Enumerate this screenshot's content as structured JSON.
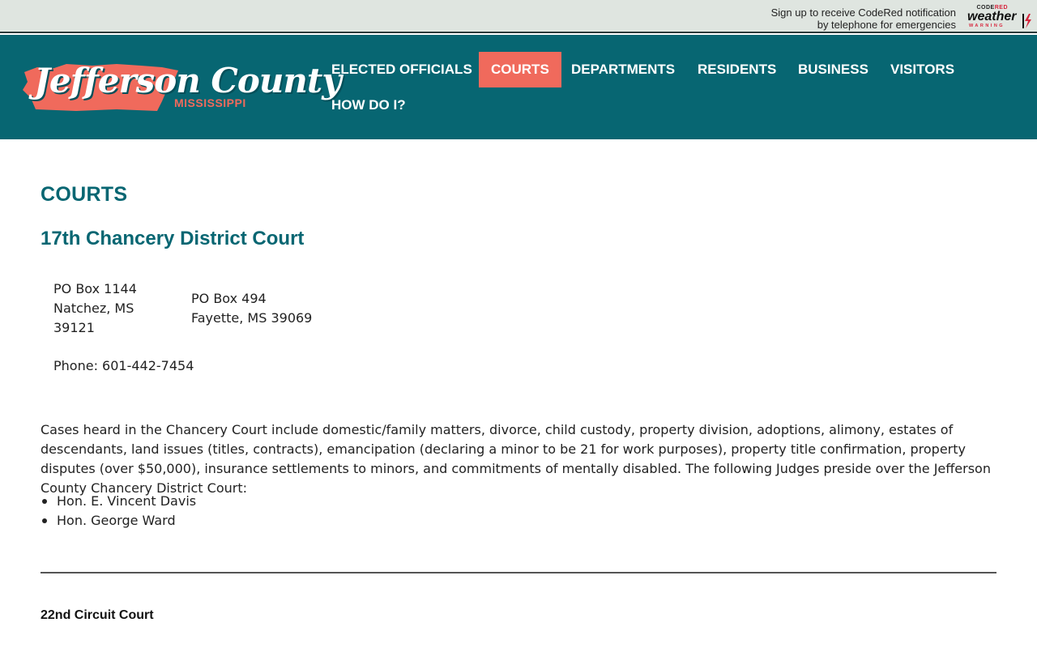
{
  "topbar": {
    "codered_line1": "Sign up to receive CodeRed notification",
    "codered_line2": "by telephone for emergencies",
    "logo_top_a": "CODE",
    "logo_top_b": "RED",
    "logo_main": "weather",
    "logo_sub": "WARNING"
  },
  "brand": {
    "name": "Jefferson County",
    "state": "MISSISSIPPI",
    "colors": {
      "teal": "#076672",
      "coral": "#f06a5c"
    }
  },
  "nav": {
    "items": [
      {
        "label": "ELECTED OFFICIALS"
      },
      {
        "label": "COURTS"
      },
      {
        "label": "DEPARTMENTS"
      },
      {
        "label": "RESIDENTS"
      },
      {
        "label": "BUSINESS"
      },
      {
        "label": "VISITORS"
      },
      {
        "label": "HOW DO I?"
      }
    ],
    "active": "COURTS"
  },
  "page": {
    "title": "COURTS",
    "court1": {
      "name": "17th Chancery District Court",
      "address1": [
        "PO Box 1144",
        "Natchez, MS",
        "39121"
      ],
      "address2": [
        "PO Box 494",
        "Fayette, MS 39069"
      ],
      "phone": "Phone: 601-442-7454",
      "description": "Cases heard in the Chancery Court include domestic/family matters, divorce, child custody, property division, adoptions, alimony, estates of descendants, land issues (titles, contracts), emancipation (declaring a minor to be 21 for work purposes), property title confirmation, property disputes (over $50,000), insurance settlements to minors, and commitments of mentally disabled. The following Judges preside over the Jefferson County Chancery District Court:",
      "judges": [
        "Hon. E. Vincent Davis",
        "Hon. George Ward"
      ]
    },
    "court2": {
      "name": "22nd Circuit Court"
    }
  }
}
